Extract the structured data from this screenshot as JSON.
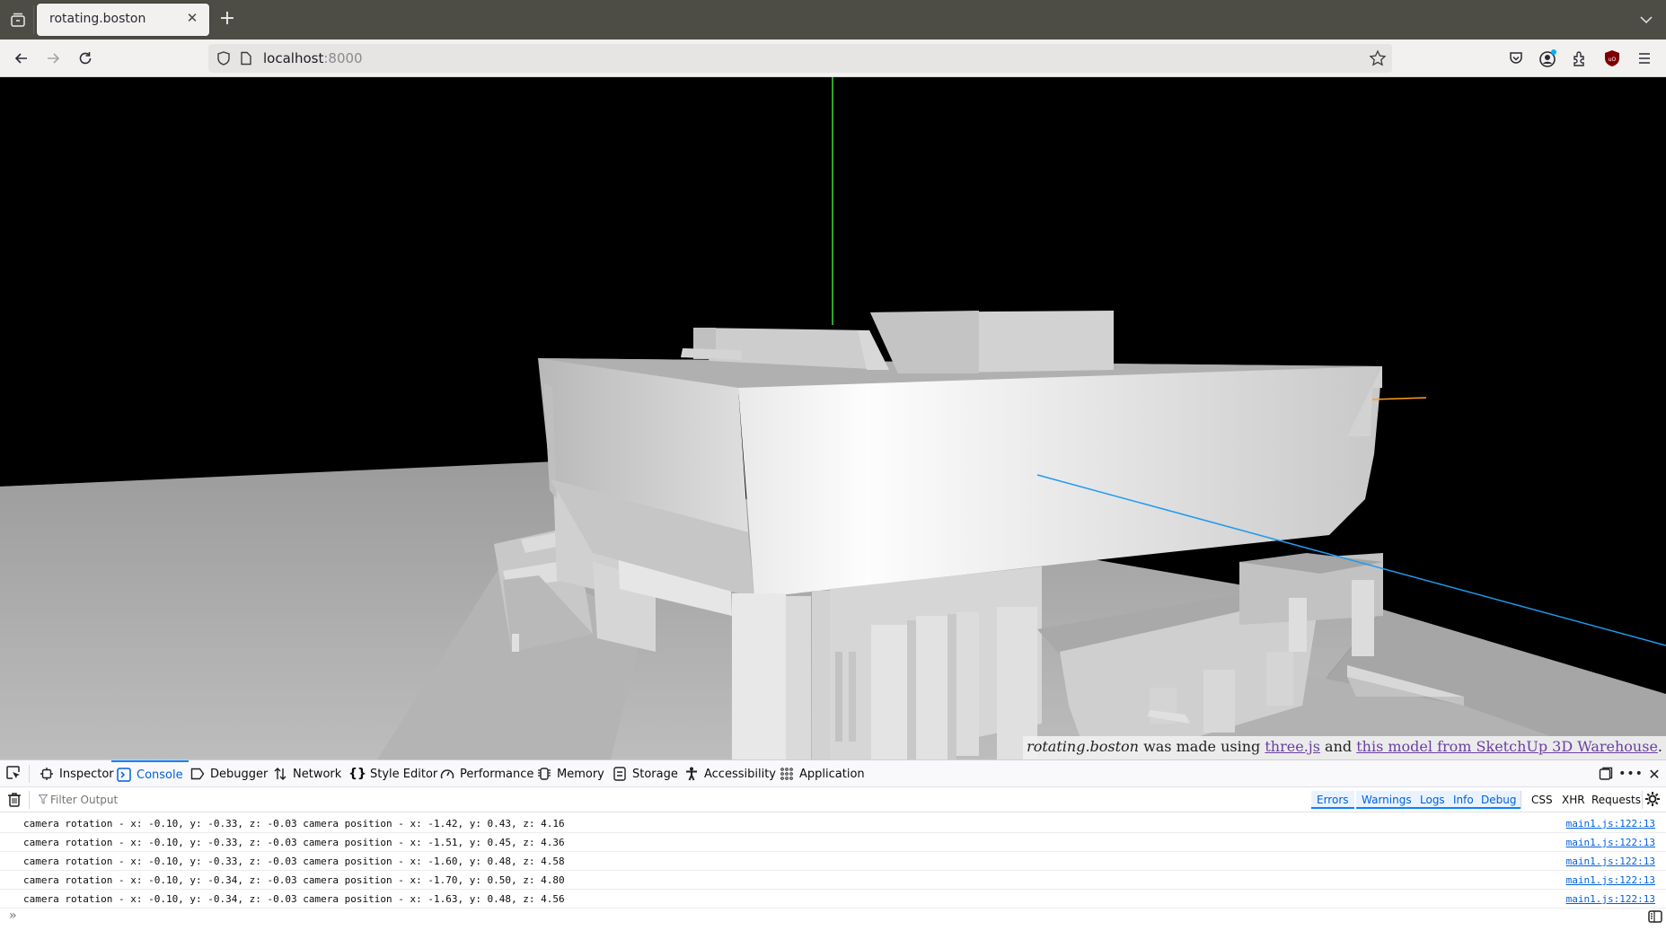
{
  "browser": {
    "tab": {
      "title": "rotating.boston",
      "close_icon": "close-icon"
    },
    "new_tab_label": "+",
    "url": {
      "host": "localhost",
      "port": ":8000"
    },
    "toolbar_icons": [
      "pocket-icon",
      "account-icon",
      "extensions-icon",
      "ublock-icon",
      "menu-icon"
    ],
    "account_badge_color": "#00b3f4"
  },
  "scene": {
    "background_color": "#000000",
    "ground_color": "#a9a9a9",
    "axis_colors": {
      "y": "#3ddc3d",
      "x": "#ff9f1a",
      "z": "#1e9bf0"
    }
  },
  "credit": {
    "site_name": "rotating.boston",
    "text1": " was made using ",
    "link1": "three.js",
    "text2": " and ",
    "link2": "this model from SketchUp 3D Warehouse",
    "text3": "."
  },
  "devtools": {
    "tabs": [
      {
        "label": "Inspector",
        "icon": "inspector-icon"
      },
      {
        "label": "Console",
        "icon": "console-icon",
        "active": true
      },
      {
        "label": "Debugger",
        "icon": "debugger-icon"
      },
      {
        "label": "Network",
        "icon": "network-icon"
      },
      {
        "label": "Style Editor",
        "icon": "style-editor-icon"
      },
      {
        "label": "Performance",
        "icon": "performance-icon"
      },
      {
        "label": "Memory",
        "icon": "memory-icon"
      },
      {
        "label": "Storage",
        "icon": "storage-icon"
      },
      {
        "label": "Accessibility",
        "icon": "accessibility-icon"
      },
      {
        "label": "Application",
        "icon": "application-icon"
      }
    ],
    "filter_placeholder": "Filter Output",
    "levels": [
      "Errors",
      "Warnings",
      "Logs",
      "Info",
      "Debug"
    ],
    "extra_filters": [
      "CSS",
      "XHR",
      "Requests"
    ],
    "logs": [
      {
        "message": "camera rotation - x: -0.10, y: -0.33, z: -0.03 camera position - x: -1.42, y: 0.43, z: 4.16",
        "source": "main1.js:122:13"
      },
      {
        "message": "camera rotation - x: -0.10, y: -0.33, z: -0.03 camera position - x: -1.51, y: 0.45, z: 4.36",
        "source": "main1.js:122:13"
      },
      {
        "message": "camera rotation - x: -0.10, y: -0.33, z: -0.03 camera position - x: -1.60, y: 0.48, z: 4.58",
        "source": "main1.js:122:13"
      },
      {
        "message": "camera rotation - x: -0.10, y: -0.34, z: -0.03 camera position - x: -1.70, y: 0.50, z: 4.80",
        "source": "main1.js:122:13"
      },
      {
        "message": "camera rotation - x: -0.10, y: -0.34, z: -0.03 camera position - x: -1.63, y: 0.48, z: 4.56",
        "source": "main1.js:122:13"
      }
    ],
    "prompt_symbol": "»"
  }
}
